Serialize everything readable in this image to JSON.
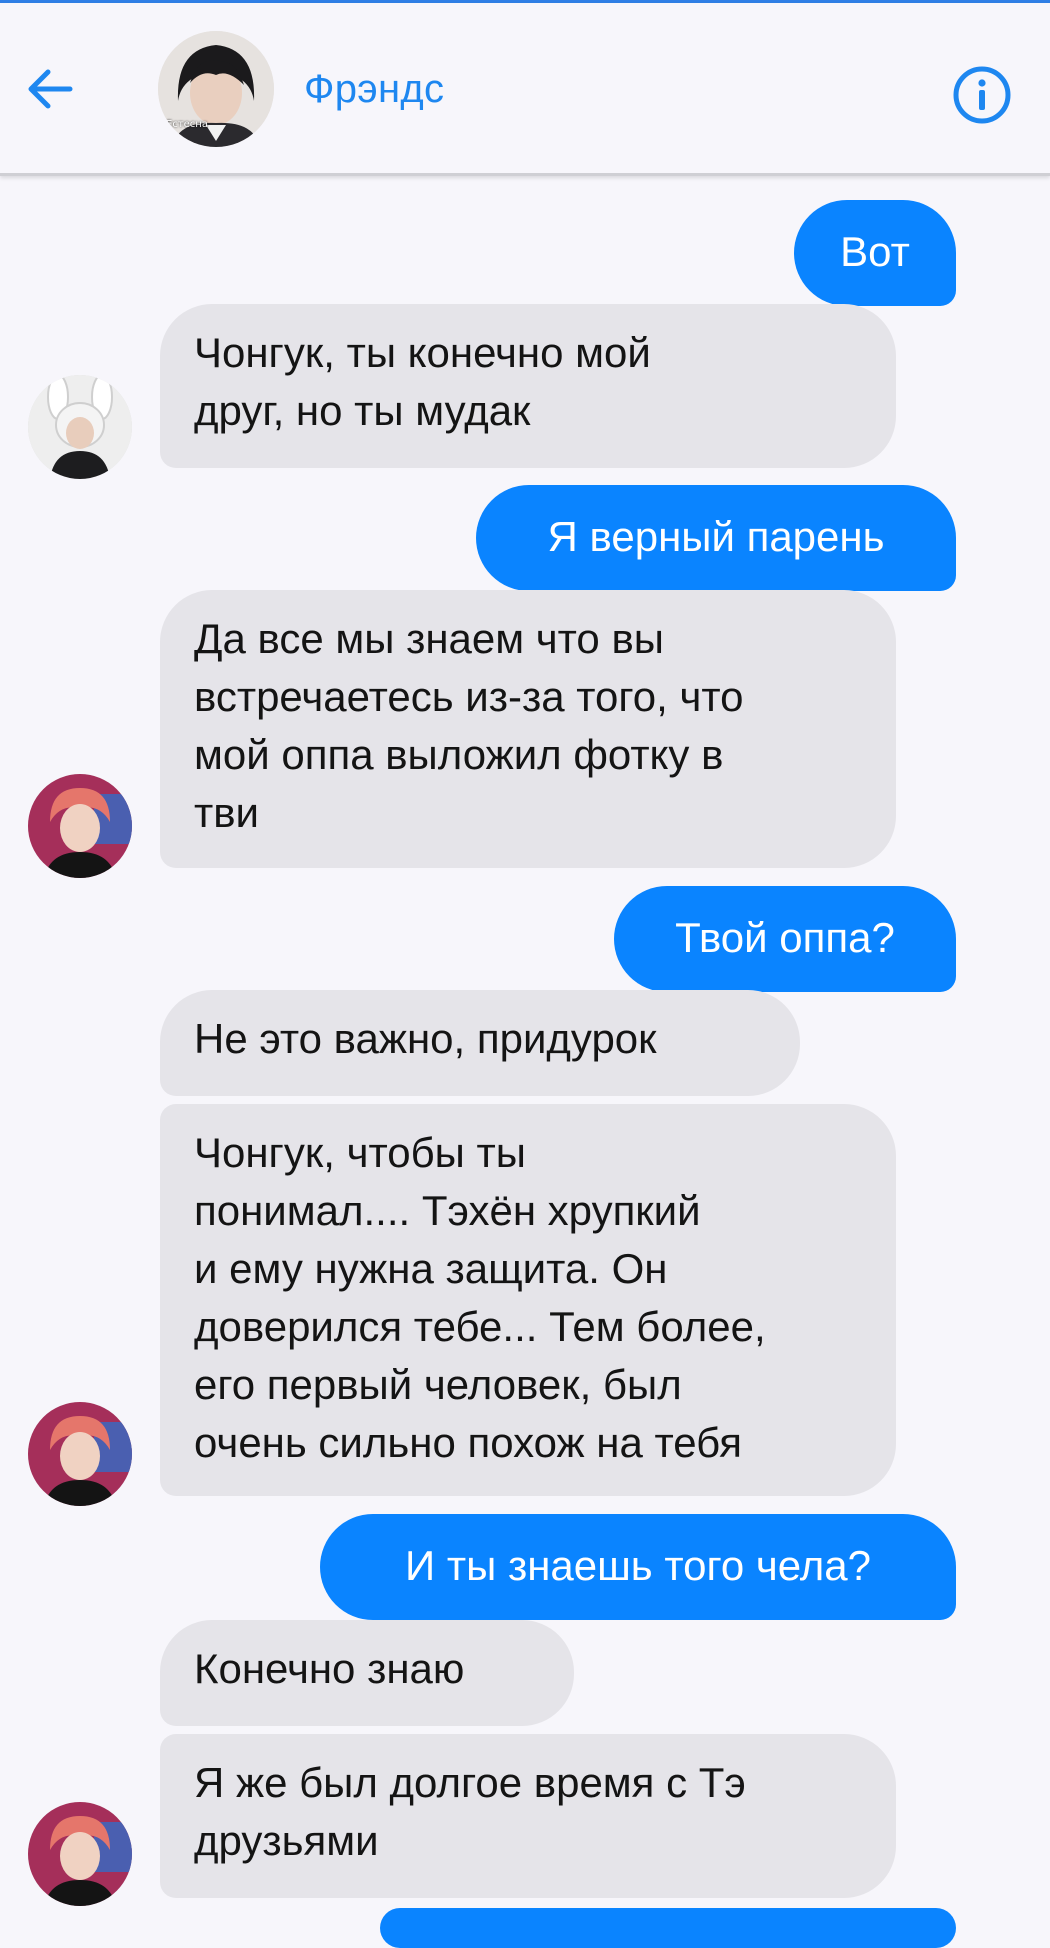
{
  "header": {
    "title": "Фрэндс",
    "avatar_caption": "Естесна"
  },
  "messages": [
    {
      "side": "out",
      "text": "Вот"
    },
    {
      "side": "in",
      "text": "Чонгук, ты конечно мой\nдруг, но ты мудак"
    },
    {
      "side": "out",
      "text": "Я верный парень"
    },
    {
      "side": "in",
      "text": "Да все мы знаем что вы\nвстречаетесь из-за того, что\nмой оппа выложил фотку в\nтви"
    },
    {
      "side": "out",
      "text": "Твой оппа?"
    },
    {
      "side": "in",
      "text": "Не это важно, придурок"
    },
    {
      "side": "in",
      "text": "Чонгук, чтобы ты\nпонимал.... Тэхён хрупкий\nи ему нужна защита. Он\nдоверился тебе... Тем более,\nего первый человек, был\nочень сильно похож на тебя"
    },
    {
      "side": "out",
      "text": "И ты знаешь того чела?"
    },
    {
      "side": "in",
      "text": "Конечно знаю"
    },
    {
      "side": "in",
      "text": "Я же был долгое время с Тэ\nдрузьями"
    }
  ],
  "colors": {
    "accent": "#0a84ff",
    "title": "#1e87f0",
    "incoming_bubble": "#e5e4e9",
    "background": "#f7f6fb"
  },
  "icons": {
    "back": "arrow-left-icon",
    "info": "info-icon"
  }
}
